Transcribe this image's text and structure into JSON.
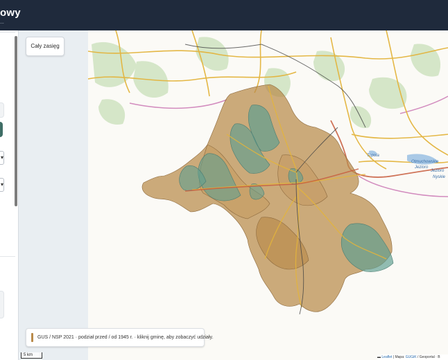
{
  "header": {
    "title": "owy",
    "subtitle": "..."
  },
  "map": {
    "reset_button_label": "Cały zasięg",
    "legend_text": "GUS / NSP 2021 · podział przed / od 1945 r. · kliknij gminę, aby zobaczyć udziały.",
    "scale_label": "5 km",
    "attribution": {
      "leaflet": "Leaflet",
      "sep": " | Mapa: ",
      "source1": "GUGiK",
      "source2": " / Geoportal · B"
    },
    "place_labels": [
      "Topola",
      "Otmuchowskie",
      "Jezioro",
      "Jezioro",
      "Nyskie"
    ],
    "colors": {
      "brown": "#b98a4a",
      "teal": "#5f9e90",
      "road": "#e3b43c",
      "rail": "#444444",
      "border": "#c86fb0"
    }
  }
}
